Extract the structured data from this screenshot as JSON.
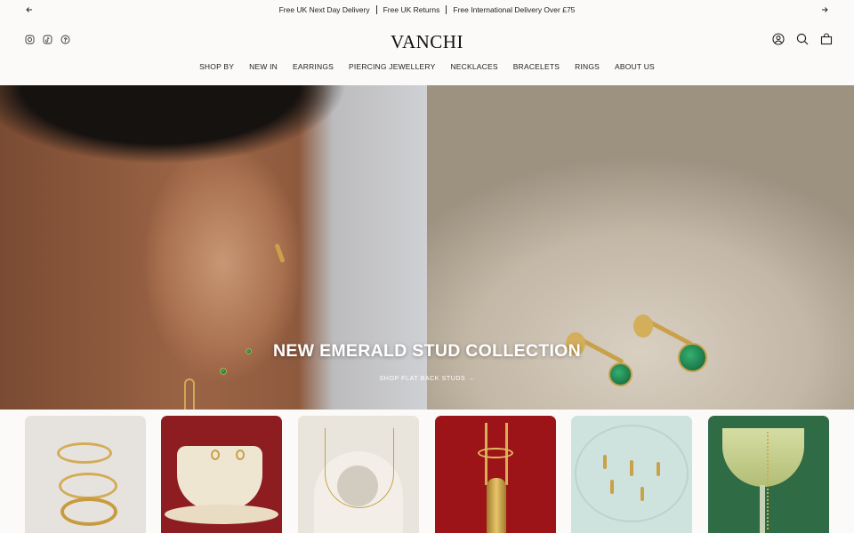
{
  "announcement": {
    "messages": [
      "Free UK Next Day Delivery",
      "Free UK Returns",
      "Free International Delivery Over £75"
    ],
    "prev_icon": "arrow-left-icon",
    "next_icon": "arrow-right-icon"
  },
  "header": {
    "logo": "VANCHI",
    "social_icons": [
      "instagram-icon",
      "tiktok-icon",
      "pinterest-icon"
    ],
    "tool_icons": [
      "account-icon",
      "search-icon",
      "bag-icon"
    ]
  },
  "nav": {
    "items": [
      "SHOP BY",
      "NEW IN",
      "EARRINGS",
      "PIERCING JEWELLERY",
      "NECKLACES",
      "BRACELETS",
      "RINGS",
      "ABOUT US"
    ]
  },
  "hero": {
    "title": "NEW EMERALD STUD COLLECTION",
    "cta": "SHOP FLAT BACK STUDS →"
  },
  "colors": {
    "background": "#fbfaf8",
    "card_1": "#e6e3df",
    "card_2": "#8e1d22",
    "card_3": "#e9e4dc",
    "card_4": "#9c1418",
    "card_5": "#cfe3de",
    "card_6": "#2f6b45"
  }
}
